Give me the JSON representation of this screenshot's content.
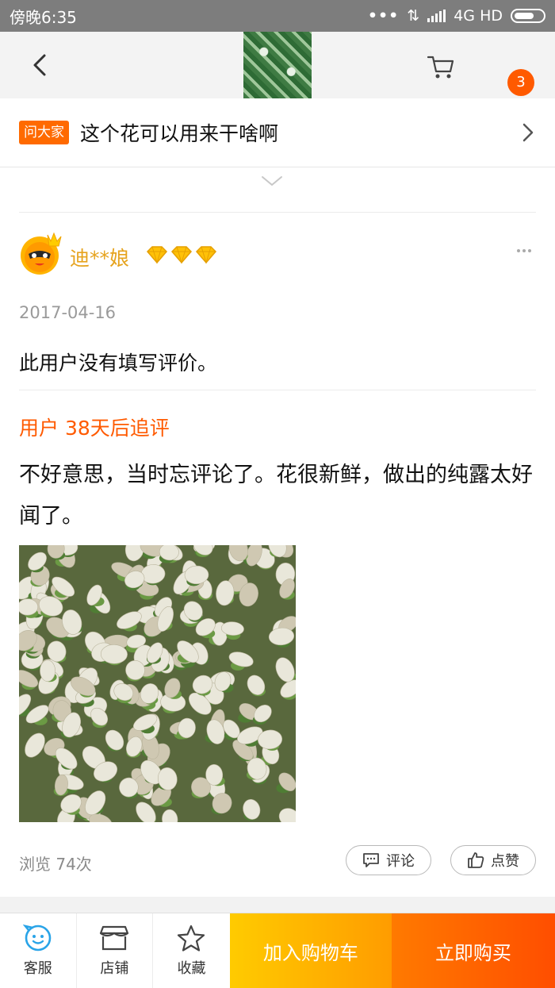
{
  "status_bar": {
    "time": "傍晚6:35",
    "network": "4G HD"
  },
  "navbar": {
    "cart_badge": "3"
  },
  "ask": {
    "tag": "问大家",
    "question": "这个花可以用来干啥啊"
  },
  "review": {
    "username": "迪**娘",
    "date": "2017-04-16",
    "text": "此用户没有填写评价。",
    "followup_title": "用户 38天后追评",
    "followup_text": "不好意思，当时忘评论了。花很新鲜，做出的纯露太好闻了。",
    "views": "浏览 74次",
    "comment_label": "评论",
    "like_label": "点赞"
  },
  "bottom_bar": {
    "service": "客服",
    "shop": "店铺",
    "favorite": "收藏",
    "add_to_cart": "加入购物车",
    "buy_now": "立即购买"
  },
  "colors": {
    "accent": "#ff5a00",
    "gold": "#e6a31e",
    "cart_button": "#ffb400",
    "buy_button": "#ff5a00"
  }
}
